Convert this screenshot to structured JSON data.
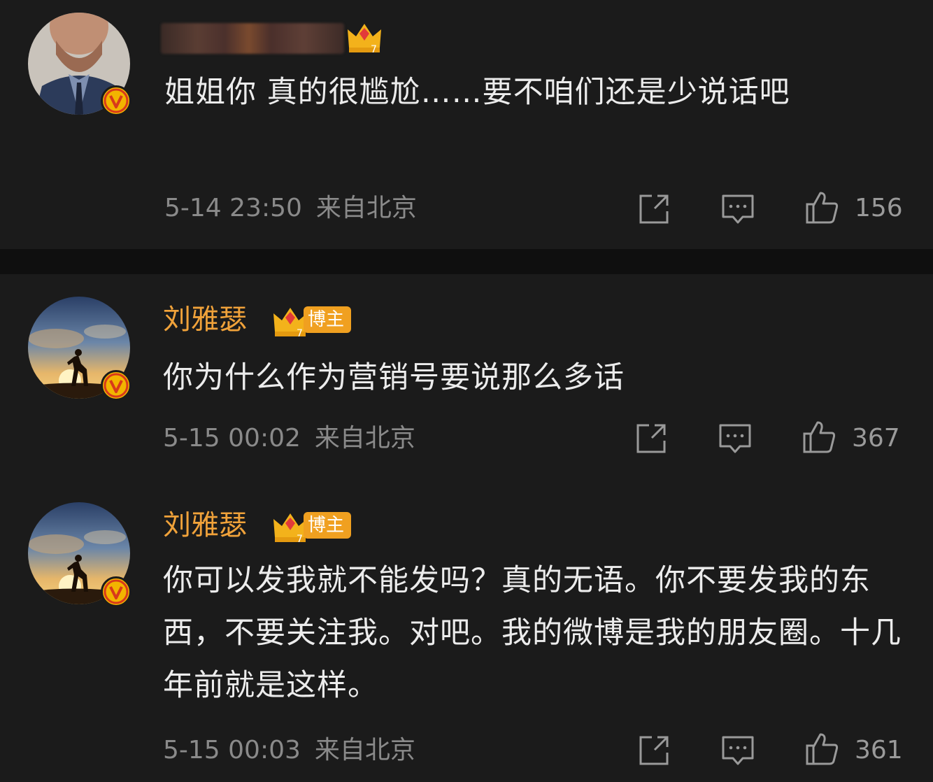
{
  "comments": [
    {
      "username": "",
      "username_hidden": true,
      "content": "姐姐你 真的很尴尬……要不咱们还是少说话吧",
      "time": "5-14 23:50",
      "location": "来自北京",
      "likes": "156"
    },
    {
      "username": "刘雅瑟",
      "badge": "博主",
      "content": "你为什么作为营销号要说那么多话",
      "time": "5-15 00:02",
      "location": "来自北京",
      "likes": "367"
    },
    {
      "username": "刘雅瑟",
      "badge": "博主",
      "content": "你可以发我就不能发吗？真的无语。你不要发我的东西，不要关注我。对吧。我的微博是我的朋友圈。十几年前就是这样。",
      "time": "5-15 00:03",
      "location": "来自北京",
      "likes": "361"
    }
  ],
  "icons": {
    "share": "share-icon",
    "reply": "comment-icon",
    "like": "thumbs-up-icon",
    "verified": "verified-v-icon",
    "crown": "crown-level-icon"
  },
  "colors": {
    "background": "#1b1b1b",
    "username": "#f0a23a",
    "badge": "#f0a020",
    "meta": "#8a8a8a"
  }
}
